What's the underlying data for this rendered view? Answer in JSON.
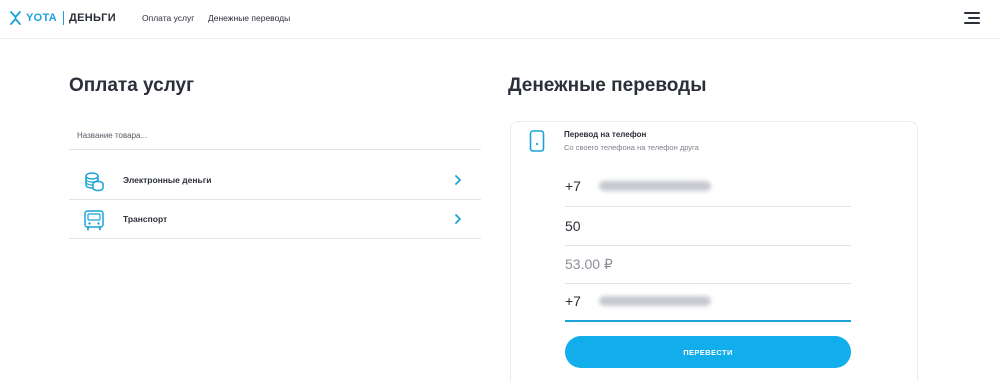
{
  "header": {
    "logo_brand": "YOTA",
    "logo_product": "ДЕНЬГИ",
    "nav": [
      {
        "label": "Оплата услуг"
      },
      {
        "label": "Денежные переводы"
      }
    ],
    "menu_icon": "hamburger-menu-icon"
  },
  "services": {
    "title": "Оплата услуг",
    "search_placeholder": "Название товара...",
    "items": [
      {
        "label": "Электронные деньги",
        "icon": "coins-icon"
      },
      {
        "label": "Транспорт",
        "icon": "bus-icon"
      }
    ]
  },
  "transfers": {
    "title": "Денежные переводы",
    "card": {
      "icon": "phone-icon",
      "title": "Перевод на телефон",
      "subtitle": "Со своего телефона на телефон друга"
    },
    "fields": {
      "from_prefix": "+7",
      "amount": "50",
      "total": "53.00 ₽",
      "to_prefix": "+7"
    },
    "submit_label": "ПЕРЕВЕСТИ"
  },
  "colors": {
    "accent": "#1aa3d9",
    "button": "#12aeeb",
    "text": "#2b2f3a"
  }
}
